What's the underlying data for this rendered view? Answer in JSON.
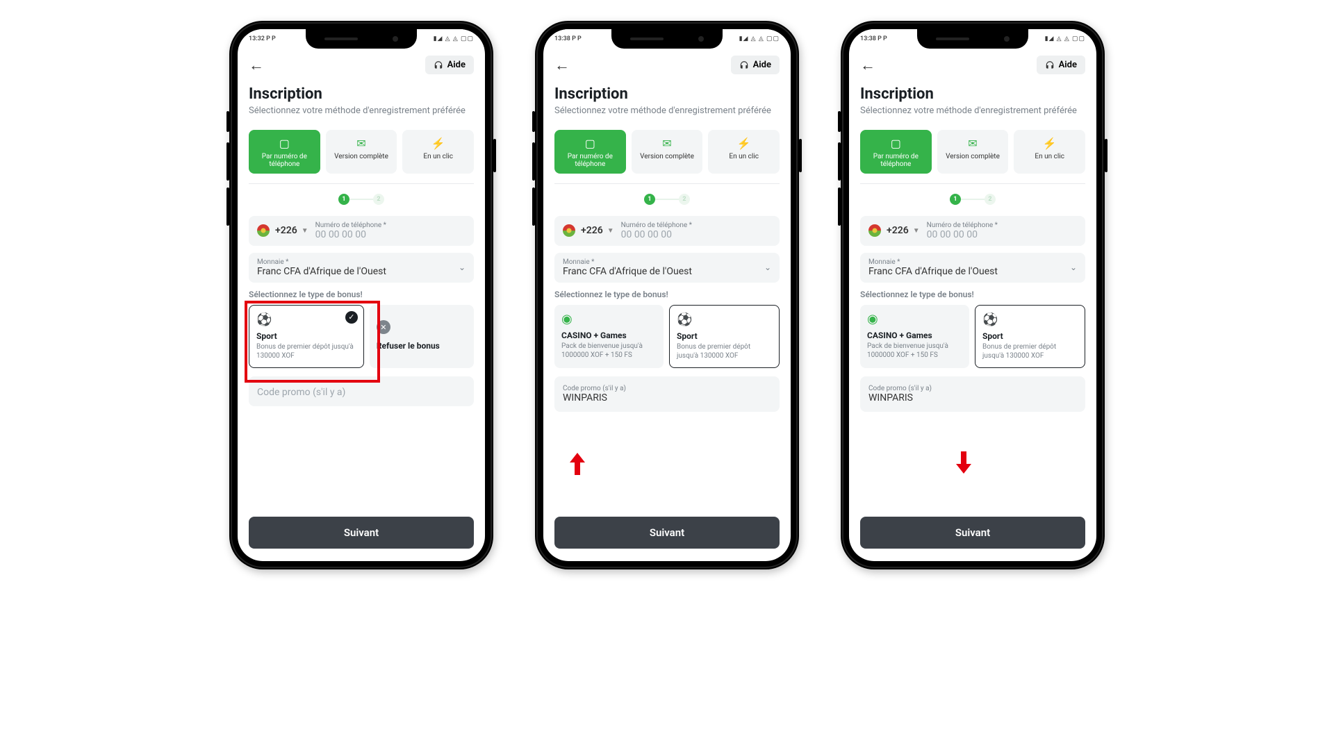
{
  "status": {
    "time1": "13:32",
    "time2": "13:38",
    "time3": "13:38",
    "left": " P  P",
    "right": "▮◢ ◬ ◬ ▢▢"
  },
  "header": {
    "help": "Aide",
    "title": "Inscription",
    "subtitle": "Sélectionnez votre méthode d'enregistrement préférée"
  },
  "methods": {
    "phone": "Par numéro de téléphone",
    "full": "Version complète",
    "oneclick": "En un clic"
  },
  "stepper": {
    "s1": "1",
    "s2": "2"
  },
  "phone_field": {
    "dial": "+226",
    "label": "Numéro de téléphone *",
    "placeholder": "00 00 00 00"
  },
  "currency": {
    "label": "Monnaie *",
    "value": "Franc CFA d'Afrique de l'Ouest"
  },
  "bonus_label": "Sélectionnez le type de bonus!",
  "bonus_phone1": {
    "a_title": "Sport",
    "a_desc": "Bonus de premier dépôt jusqu'à 130000 XOF",
    "b_title": "Refuser le bonus"
  },
  "bonus_phone23": {
    "a_title": "CASINO + Games",
    "a_desc": "Pack de bienvenue jusqu'à 1000000 XOF + 150 FS",
    "b_title": "Sport",
    "b_desc": "Bonus de premier dépôt jusqu'à 130000 XOF"
  },
  "promo": {
    "placeholder": "Code promo (s'il y a)",
    "label": "Code promo (s'il y a)",
    "value": "WINPARIS"
  },
  "next": "Suivant"
}
